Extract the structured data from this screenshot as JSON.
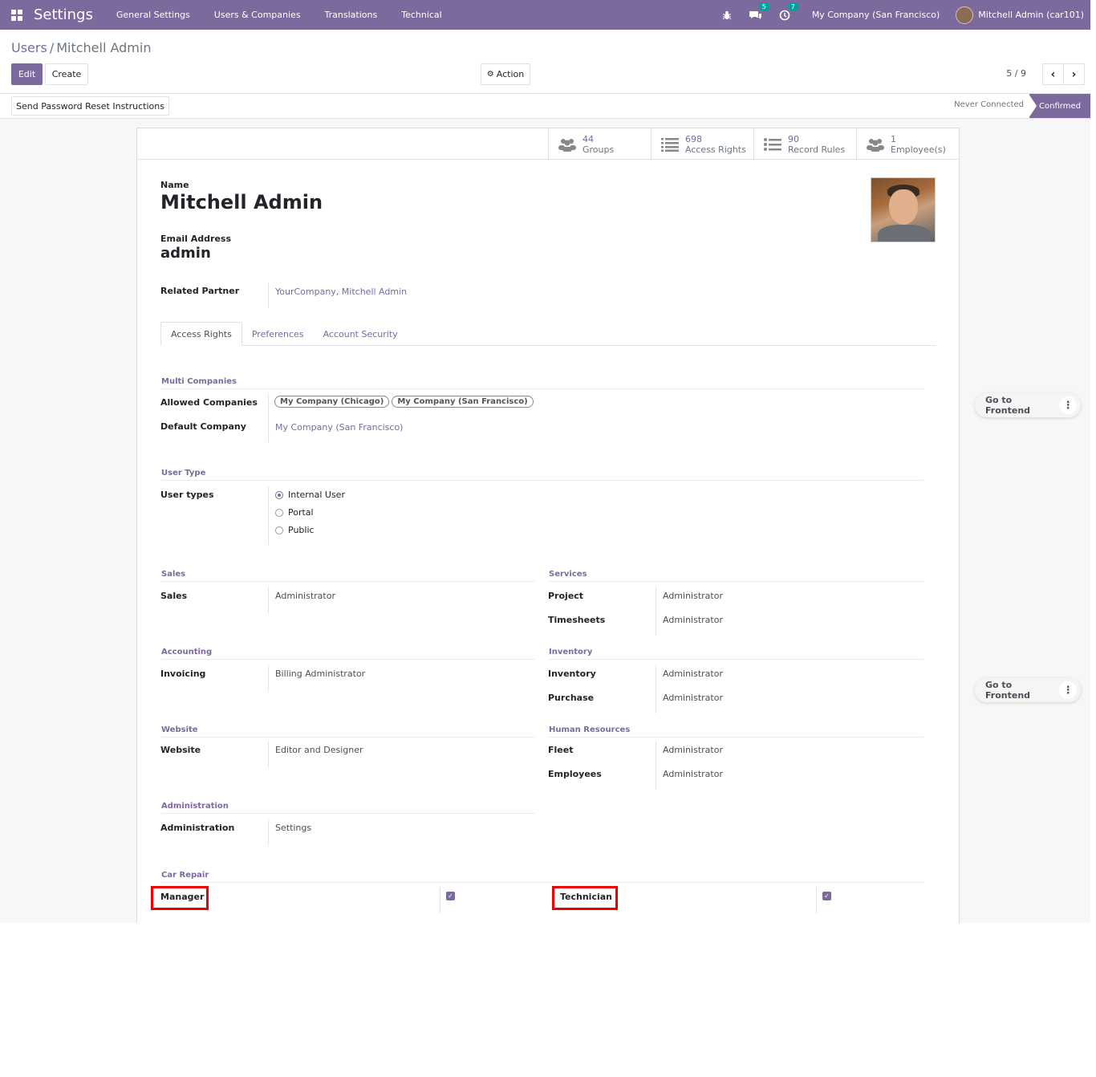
{
  "navbar": {
    "brand": "Settings",
    "menu": [
      "General Settings",
      "Users & Companies",
      "Translations",
      "Technical"
    ],
    "messages_badge": "5",
    "activities_badge": "7",
    "company": "My Company (San Francisco)",
    "user": "Mitchell Admin (car101)"
  },
  "breadcrumb": {
    "parent": "Users",
    "separator": "/",
    "current": "Mitchell Admin"
  },
  "toolbar": {
    "edit_label": "Edit",
    "create_label": "Create",
    "action_label": "Action",
    "pager": "5 / 9"
  },
  "statusbar": {
    "reset_button": "Send Password Reset Instructions",
    "never_connected": "Never Connected",
    "confirmed": "Confirmed"
  },
  "smart_buttons": [
    {
      "count": "44",
      "label": "Groups"
    },
    {
      "count": "698",
      "label": "Access Rights"
    },
    {
      "count": "90",
      "label": "Record Rules"
    },
    {
      "count": "1",
      "label": "Employee(s)"
    }
  ],
  "form": {
    "name_label": "Name",
    "name": "Mitchell Admin",
    "email_label": "Email Address",
    "login": "admin",
    "partner_label": "Related Partner",
    "partner": "YourCompany, Mitchell Admin"
  },
  "tabs": [
    "Access Rights",
    "Preferences",
    "Account Security"
  ],
  "multi_companies": {
    "title": "Multi Companies",
    "allowed_label": "Allowed Companies",
    "allowed": [
      "My Company (Chicago)",
      "My Company (San Francisco)"
    ],
    "default_label": "Default Company",
    "default": "My Company (San Francisco)"
  },
  "user_type": {
    "title": "User Type",
    "label": "User types",
    "options": [
      "Internal User",
      "Portal",
      "Public"
    ],
    "selected": "Internal User"
  },
  "groups_left": [
    {
      "title": "Sales",
      "rows": [
        {
          "label": "Sales",
          "value": "Administrator"
        }
      ]
    },
    {
      "title": "Accounting",
      "rows": [
        {
          "label": "Invoicing",
          "value": "Billing Administrator"
        }
      ]
    },
    {
      "title": "Website",
      "rows": [
        {
          "label": "Website",
          "value": "Editor and Designer"
        }
      ]
    },
    {
      "title": "Administration",
      "rows": [
        {
          "label": "Administration",
          "value": "Settings"
        }
      ]
    }
  ],
  "groups_right": [
    {
      "title": "Services",
      "rows": [
        {
          "label": "Project",
          "value": "Administrator"
        },
        {
          "label": "Timesheets",
          "value": "Administrator"
        }
      ]
    },
    {
      "title": "Inventory",
      "rows": [
        {
          "label": "Inventory",
          "value": "Administrator"
        },
        {
          "label": "Purchase",
          "value": "Administrator"
        }
      ]
    },
    {
      "title": "Human Resources",
      "rows": [
        {
          "label": "Fleet",
          "value": "Administrator"
        },
        {
          "label": "Employees",
          "value": "Administrator"
        }
      ]
    }
  ],
  "car_repair": {
    "title": "Car Repair",
    "manager_label": "Manager",
    "technician_label": "Technician",
    "manager_checked": true,
    "technician_checked": true,
    "highlight_color": "#ee0000"
  },
  "float_button": {
    "label": "Go to Frontend"
  },
  "colors": {
    "brand": "#7c6a9f",
    "badge": "#00a09d"
  }
}
